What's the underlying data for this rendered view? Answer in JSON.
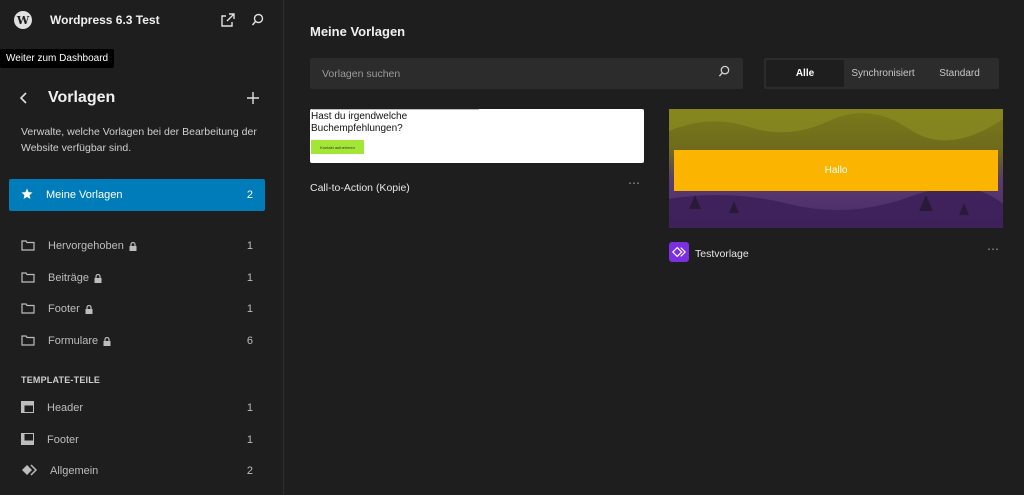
{
  "topbar": {
    "site_title": "Wordpress 6.3 Test",
    "tooltip": "Weiter zum Dashboard"
  },
  "sidebar": {
    "title": "Vorlagen",
    "description": "Verwalte, welche Vorlagen bei der Bearbeitung der Website verfügbar sind.",
    "active_item": {
      "label": "Meine Vorlagen",
      "count": "2"
    },
    "categories": [
      {
        "label": "Hervorgehoben",
        "count": "1"
      },
      {
        "label": "Beiträge",
        "count": "1"
      },
      {
        "label": "Footer",
        "count": "1"
      },
      {
        "label": "Formulare",
        "count": "6"
      }
    ],
    "template_parts_heading": "TEMPLATE-TEILE",
    "template_parts": [
      {
        "label": "Header",
        "count": "1"
      },
      {
        "label": "Footer",
        "count": "1"
      },
      {
        "label": "Allgemein",
        "count": "2"
      }
    ]
  },
  "main": {
    "title": "Meine Vorlagen",
    "search_placeholder": "Vorlagen suchen",
    "filters": [
      "Alle",
      "Synchronisiert",
      "Standard"
    ],
    "cards": [
      {
        "title": "Call-to-Action (Kopie)",
        "preview_text": "Hast du irgendwelche Buchempfehlungen?",
        "preview_button": "Kontakt aufnehmen"
      },
      {
        "title": "Testvorlage",
        "preview_text": "Hallo"
      }
    ]
  },
  "colors": {
    "accent": "#007cba",
    "sync_badge": "#7b2fe0",
    "cta_button": "#a3e635",
    "hallo_banner": "#fbb500"
  },
  "icons": {
    "logo": "wordpress-logo-icon",
    "external": "external-link-icon",
    "search": "search-icon",
    "back": "chevron-left-icon",
    "add": "plus-icon",
    "star": "star-icon",
    "folder": "folder-icon",
    "lock": "lock-icon",
    "header": "header-layout-icon",
    "footer": "footer-layout-icon",
    "general": "symbol-diamond-icon"
  }
}
